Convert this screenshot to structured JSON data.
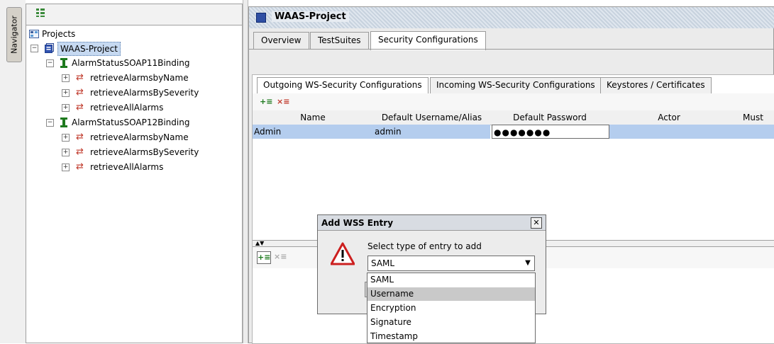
{
  "navigator": {
    "tab_label": "Navigator",
    "tree": {
      "root": "Projects",
      "project": "WAAS-Project",
      "bindings": [
        {
          "name": "AlarmStatusSOAP11Binding",
          "operations": [
            "retrieveAlarmsbyName",
            "retrieveAlarmsBySeverity",
            "retrieveAllAlarms"
          ]
        },
        {
          "name": "AlarmStatusSOAP12Binding",
          "operations": [
            "retrieveAlarmsbyName",
            "retrieveAlarmsBySeverity",
            "retrieveAllAlarms"
          ]
        }
      ]
    }
  },
  "project_panel": {
    "title": "WAAS-Project",
    "tabs": [
      "Overview",
      "TestSuites",
      "Security Configurations"
    ],
    "active_tab": "Security Configurations",
    "inner_tabs": [
      "Outgoing WS-Security Configurations",
      "Incoming WS-Security Configurations",
      "Keystores / Certificates"
    ],
    "active_inner_tab": "Outgoing WS-Security Configurations",
    "table": {
      "columns": [
        "Name",
        "Default Username/Alias",
        "Default Password",
        "Actor",
        "Must"
      ],
      "rows": [
        {
          "name": "Admin",
          "username": "admin",
          "password": "●●●●●●●",
          "actor": "",
          "must": ""
        }
      ]
    }
  },
  "dialog": {
    "title": "Add WSS Entry",
    "close_label": "✕",
    "prompt": "Select type of entry to add",
    "selected": "SAML",
    "options": [
      "SAML",
      "Username",
      "Encryption",
      "Signature",
      "Timestamp"
    ],
    "highlighted_option": "Username"
  },
  "icons": {
    "add": "add-entry-icon",
    "remove": "remove-entry-icon",
    "warning": "warning-icon"
  },
  "colors": {
    "selection": "#b4cdee",
    "tree_selection": "#c6d9f1",
    "warning_red": "#cc1f1f",
    "binding_green": "#1e7a1e",
    "operation_red": "#c0392b"
  }
}
